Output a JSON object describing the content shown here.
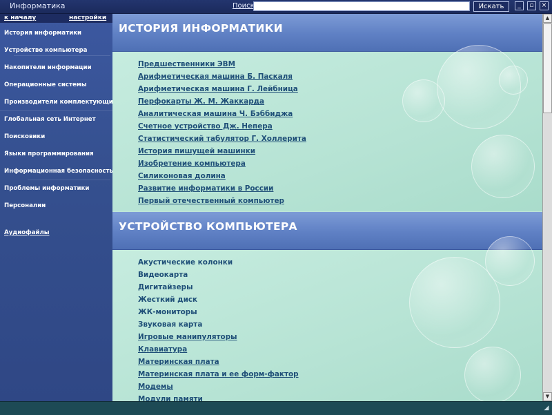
{
  "window": {
    "title": "Информатика",
    "search_label": "Поиск",
    "search_value": "",
    "search_button": "Искать",
    "minimize_glyph": "_",
    "restore_glyph": "▫",
    "close_glyph": "×"
  },
  "sidebar": {
    "top_links": {
      "home": "к началу",
      "settings": "настройки"
    },
    "items": [
      {
        "label": "История информатики"
      },
      {
        "label": "Устройство компьютера"
      },
      {
        "label": "Накопители информации"
      },
      {
        "label": "Операционные системы"
      },
      {
        "label": "Производители комплектующих"
      },
      {
        "label": "Глобальная сеть Интернет"
      },
      {
        "label": "Поисковики"
      },
      {
        "label": "Языки программирования"
      },
      {
        "label": "Информационная безопасность"
      },
      {
        "label": "Проблемы информатики"
      },
      {
        "label": "Персоналии"
      }
    ],
    "audio_link": "Аудиофайлы"
  },
  "main": {
    "sections": [
      {
        "title": "ИСТОРИЯ ИНФОРМАТИКИ",
        "links": [
          "Предшественники ЭВМ",
          "Арифметическая машина Б. Паскаля",
          "Арифметическая машина Г. Лейбница",
          "Перфокарты Ж. М. Жаккарда",
          "Аналитическая машина Ч. Бэббиджа",
          "Счетное устройство Дж. Непера",
          "Статистический табулятор Г. Холлерита",
          "История пишущей машинки",
          "Изобретение компьютера",
          "Силиконовая долина",
          "Развитие информатики в России",
          "Первый отечественный компьютер"
        ]
      },
      {
        "title": "УСТРОЙСТВО КОМПЬЮТЕРА",
        "links": [
          "Акустические колонки",
          "Видеокарта",
          "Дигитайзеры",
          "Жесткий диск",
          "ЖК-мониторы",
          "Звуковая карта",
          "Игровые манипуляторы",
          "Клавиатура",
          "Материнская плата",
          "Материнская плата и ее форм-фактор",
          "Модемы",
          "Модули памяти"
        ]
      }
    ]
  },
  "scrollbar": {
    "up_glyph": "▲",
    "down_glyph": "▼",
    "position": 0
  },
  "statusbar": {
    "corner_glyph": "◢"
  },
  "colors": {
    "sidebar_bg": "#3c58a0",
    "header_bg": "#5f80c4",
    "content_bg": "#bfe6d8",
    "link_color": "#1f4f78"
  }
}
